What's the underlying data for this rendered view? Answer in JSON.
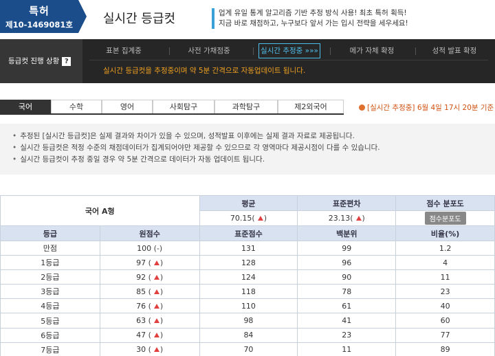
{
  "header": {
    "patent_label": "특허",
    "patent_number": "제10-1469081호",
    "title": "실시간 등급컷",
    "slogan_line1": "업계 유일 통계 알고리즘 기반 추정 방식 사용! 최초 특허 획득!",
    "slogan_line2": "지금 바로 채점하고, 누구보다 앞서 가는 입시 전략을 세우세요!"
  },
  "status_panel": {
    "label": "등급컷 진행 상황",
    "help_icon": "?",
    "steps": [
      "표본 집계중",
      "사전 가채점중",
      "실시간 추정중 »»»",
      "메가 자체 확정",
      "성적 발표 확정"
    ],
    "active_step": 2,
    "message": "실시간 등급컷을 추정중이며 약 5분 간격으로 자동업데이트 됩니다."
  },
  "tabs": {
    "items": [
      "국어",
      "수학",
      "영어",
      "사회탐구",
      "과학탐구",
      "제2외국어"
    ],
    "active": 0,
    "notice": "[실시간 추정중] 6월 4일 17시 20분 기준"
  },
  "notices": [
    "추정된 [실시간 등급컷]은 실제 결과와 차이가 있을 수 있으며, 성적발표 이후에는 실제 결과 자료로 제공됩니다.",
    "실시간 등급컷은 적정 수준의 채점데이터가 집계되어야만 제공할 수 있으므로 각 영역마다 제공시점이 다를 수 있습니다.",
    "실시간 등급컷이 추정 중일 경우 약 5분 간격으로 데이터가 자동 업데이트 됩니다."
  ],
  "summary": {
    "exam_name": "국어 A형",
    "avg_label": "평균",
    "std_label": "표준편차",
    "dist_label": "점수 분포도",
    "avg_value": "70.15",
    "std_value": "23.13",
    "dist_button": "점수분포도"
  },
  "table": {
    "columns": [
      "등급",
      "원점수",
      "표준점수",
      "백분위",
      "비율(%)"
    ],
    "rows": [
      {
        "grade": "만점",
        "raw": "100",
        "trend": "(-)",
        "standard": "131",
        "percentile": "99",
        "ratio": "1.2"
      },
      {
        "grade": "1등급",
        "raw": "97",
        "trend": "up",
        "standard": "128",
        "percentile": "96",
        "ratio": "4"
      },
      {
        "grade": "2등급",
        "raw": "92",
        "trend": "up",
        "standard": "124",
        "percentile": "90",
        "ratio": "11"
      },
      {
        "grade": "3등급",
        "raw": "85",
        "trend": "up",
        "standard": "118",
        "percentile": "78",
        "ratio": "23"
      },
      {
        "grade": "4등급",
        "raw": "76",
        "trend": "up",
        "standard": "110",
        "percentile": "61",
        "ratio": "40"
      },
      {
        "grade": "5등급",
        "raw": "63",
        "trend": "up",
        "standard": "98",
        "percentile": "41",
        "ratio": "60"
      },
      {
        "grade": "6등급",
        "raw": "47",
        "trend": "up",
        "standard": "84",
        "percentile": "23",
        "ratio": "77"
      },
      {
        "grade": "7등급",
        "raw": "30",
        "trend": "up",
        "standard": "70",
        "percentile": "11",
        "ratio": "89"
      }
    ]
  },
  "colors": {
    "brand_blue": "#1c4d8b",
    "accent_cyan": "#4fc0ee",
    "status_orange": "#f0a020",
    "table_header": "#d8e2f0",
    "trend_up": "#e04040"
  }
}
